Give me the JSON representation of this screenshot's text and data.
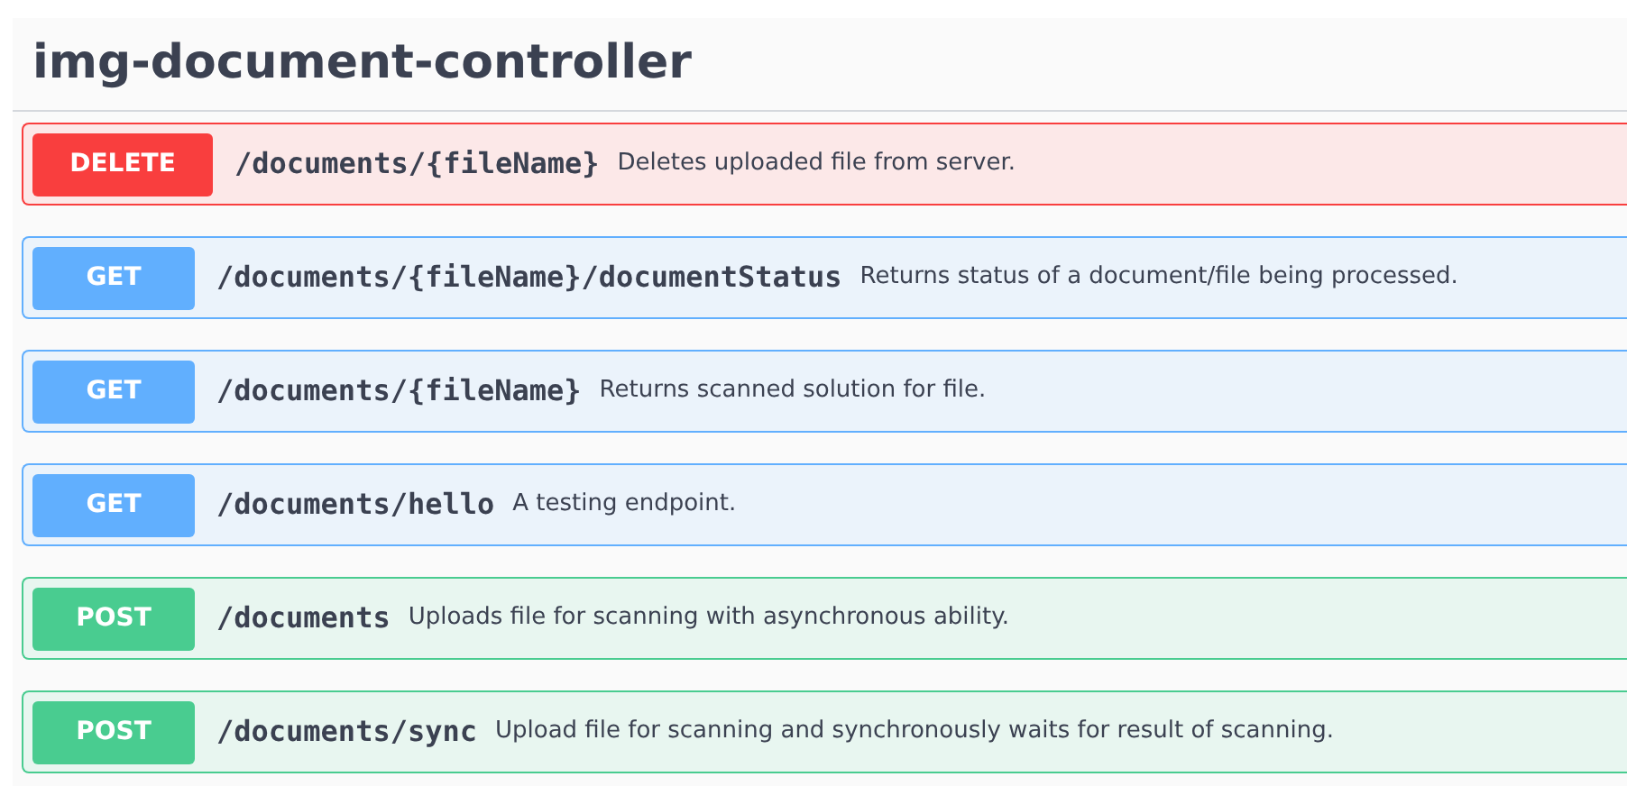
{
  "section": {
    "title": "img-document-controller"
  },
  "operations": [
    {
      "method": "DELETE",
      "kind": "delete",
      "path": "/documents/{fileName}",
      "summary": "Deletes uploaded file from server."
    },
    {
      "method": "GET",
      "kind": "get",
      "path": "/documents/{fileName}/documentStatus",
      "summary": "Returns status of a document/file being processed."
    },
    {
      "method": "GET",
      "kind": "get",
      "path": "/documents/{fileName}",
      "summary": "Returns scanned solution for file."
    },
    {
      "method": "GET",
      "kind": "get",
      "path": "/documents/hello",
      "summary": "A testing endpoint."
    },
    {
      "method": "POST",
      "kind": "post",
      "path": "/documents",
      "summary": "Uploads file for scanning with asynchronous ability."
    },
    {
      "method": "POST",
      "kind": "post",
      "path": "/documents/sync",
      "summary": "Upload file for scanning and synchronously waits for result of scanning."
    }
  ]
}
